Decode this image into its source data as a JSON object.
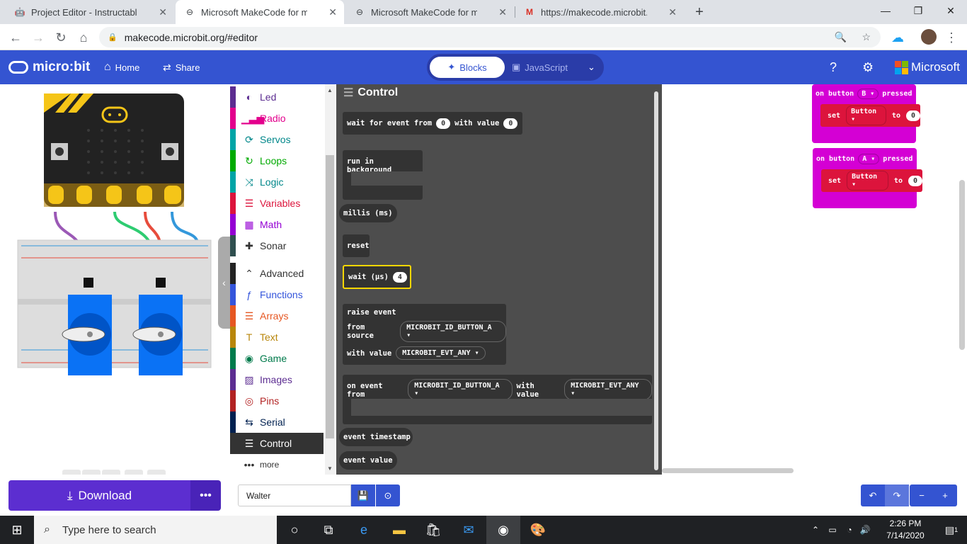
{
  "tabs": [
    {
      "label": "Project Editor - Instructables",
      "icon": "robot-icon",
      "active": false
    },
    {
      "label": "Microsoft MakeCode for micro:bit",
      "icon": "makecode-icon",
      "active": true
    },
    {
      "label": "Microsoft MakeCode for micro:bit",
      "icon": "makecode-icon",
      "active": false
    },
    {
      "label": "https://makecode.microbit.org/_l",
      "icon": "gmail-icon",
      "active": false
    }
  ],
  "address": {
    "url": "makecode.microbit.org/#editor"
  },
  "header": {
    "logo": "micro:bit",
    "home": "Home",
    "share": "Share",
    "blocks": "Blocks",
    "javascript": "JavaScript",
    "brand": "Microsoft"
  },
  "toolbox": [
    {
      "label": "Led",
      "color": "#5c2d91",
      "icon": "toggle-icon"
    },
    {
      "label": "Radio",
      "color": "#e3008c",
      "icon": "signal-icon"
    },
    {
      "label": "Servos",
      "color": "#00a4a6",
      "icon": "sync-icon"
    },
    {
      "label": "Loops",
      "color": "#00aa00",
      "icon": "loop-icon"
    },
    {
      "label": "Logic",
      "color": "#00a4a6",
      "icon": "shuffle-icon"
    },
    {
      "label": "Variables",
      "color": "#dc143c",
      "icon": "list-icon"
    },
    {
      "label": "Math",
      "color": "#9400d3",
      "icon": "calculator-icon"
    },
    {
      "label": "Sonar",
      "color": "#2f4f4f",
      "icon": "puzzle-icon"
    },
    {
      "label": "Advanced",
      "color": "#222222",
      "icon": "chevron-up-icon"
    },
    {
      "label": "Functions",
      "color": "#3455db",
      "icon": "function-icon"
    },
    {
      "label": "Arrays",
      "color": "#e65722",
      "icon": "list-icon"
    },
    {
      "label": "Text",
      "color": "#b8860b",
      "icon": "text-icon"
    },
    {
      "label": "Game",
      "color": "#007a4b",
      "icon": "gamepad-icon"
    },
    {
      "label": "Images",
      "color": "#5c2d91",
      "icon": "image-icon"
    },
    {
      "label": "Pins",
      "color": "#b22222",
      "icon": "pin-icon"
    },
    {
      "label": "Serial",
      "color": "#002050",
      "icon": "usb-icon"
    },
    {
      "label": "Control",
      "color": "#333333",
      "icon": "list-icon"
    },
    {
      "label": "more",
      "color": "#ffffff",
      "icon": "more-icon"
    }
  ],
  "flyout": {
    "title": "Control",
    "wait_event": {
      "text": "wait for event from",
      "val1": "0",
      "mid": "with value",
      "val2": "0"
    },
    "run_bg": "run in background",
    "millis": "millis (ms)",
    "reset": "reset",
    "wait_us": {
      "text": "wait (µs)",
      "val": "4"
    },
    "raise": {
      "title": "raise event",
      "from": "from source",
      "src": "MICROBIT_ID_BUTTON_A",
      "with": "with value",
      "val": "MICROBIT_EVT_ANY"
    },
    "on_event": {
      "text": "on event from",
      "src": "MICROBIT_ID_BUTTON_A",
      "with": "with value",
      "val": "MICROBIT_EVT_ANY"
    },
    "timestamp": "event timestamp",
    "value": "event value"
  },
  "workspace": {
    "block1": {
      "on": "on button",
      "btn": "B",
      "pressed": "pressed",
      "set": "set",
      "var": "Button",
      "to": "to",
      "val": "0"
    },
    "block2": {
      "on": "on button",
      "btn": "A",
      "pressed": "pressed",
      "set": "set",
      "var": "Button",
      "to": "to",
      "val": "0"
    }
  },
  "bottom": {
    "download": "Download",
    "project_name": "Walter"
  },
  "taskbar": {
    "search": "Type here to search",
    "time": "2:26 PM",
    "date": "7/14/2020",
    "notif": "1"
  }
}
